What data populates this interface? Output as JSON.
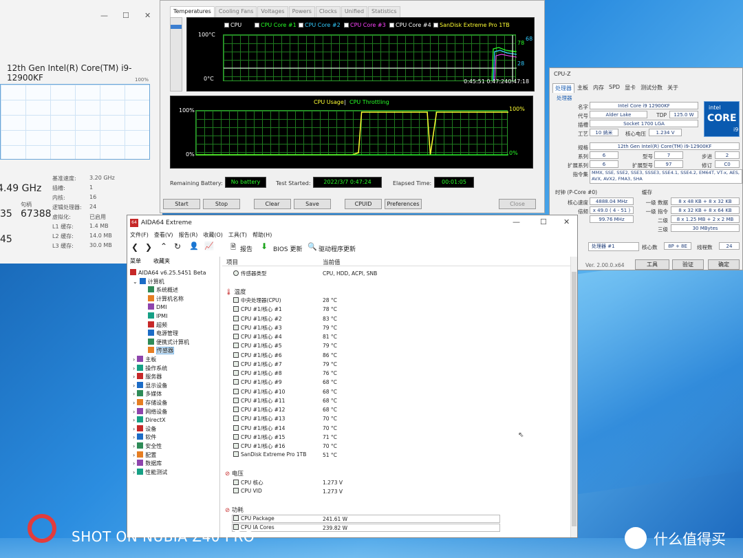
{
  "taskmanager": {
    "minimize": "—",
    "maximize": "☐",
    "close": "✕",
    "cpu_name": "12th Gen Intel(R) Core(TM) i9-12900KF",
    "graph_top": "100%",
    "speed": "4.49 GHz",
    "handles_label": "句柄",
    "num_a": "35",
    "num_b": "67388",
    "num_c": "45",
    "details": [
      {
        "label": "基准速度:",
        "value": "3.20 GHz"
      },
      {
        "label": "插槽:",
        "value": "1"
      },
      {
        "label": "内核:",
        "value": "16"
      },
      {
        "label": "逻辑处理器:",
        "value": "24"
      },
      {
        "label": "虚拟化:",
        "value": "已启用"
      },
      {
        "label": "L1 缓存:",
        "value": "1.4 MB"
      },
      {
        "label": "L2 缓存:",
        "value": "14.0 MB"
      },
      {
        "label": "L3 缓存:",
        "value": "30.0 MB"
      }
    ]
  },
  "stability": {
    "tabs": [
      "Temperatures",
      "Cooling Fans",
      "Voltages",
      "Powers",
      "Clocks",
      "Unified",
      "Statistics"
    ],
    "legend": [
      {
        "label": "CPU",
        "color": "#ffffff"
      },
      {
        "label": "CPU Core #1",
        "color": "#28ff28"
      },
      {
        "label": "CPU Core #2",
        "color": "#33ccff"
      },
      {
        "label": "CPU Core #3",
        "color": "#ff44ff"
      },
      {
        "label": "CPU Core #4",
        "color": "#ffffff"
      },
      {
        "label": "SanDisk Extreme Pro 1TB",
        "color": "#ffff33"
      }
    ],
    "temp_top": "100°C",
    "temp_bottom": "0°C",
    "temp_val_a": "78",
    "temp_val_b": "68",
    "temp_val_c": "28",
    "time_label": "0:45:51 0:47:240:47:18",
    "usage_title": "CPU Usage",
    "throttle_title": "CPU Throttling",
    "usage_top_left": "100%",
    "usage_bottom_left": "0%",
    "usage_top_right": "100%",
    "usage_bottom_right": "0%",
    "remaining_battery_label": "Remaining Battery:",
    "remaining_battery_value": "No battery",
    "test_started_label": "Test Started:",
    "test_started_value": "2022/3/7 0:47:24",
    "elapsed_label": "Elapsed Time:",
    "elapsed_value": "00:01:05",
    "buttons": {
      "start": "Start",
      "stop": "Stop",
      "clear": "Clear",
      "save": "Save",
      "cpuid": "CPUID",
      "preferences": "Preferences",
      "close": "Close"
    },
    "usage_series": [
      {
        "t": 0,
        "v": 0
      },
      {
        "t": 0.5,
        "v": 0
      },
      {
        "t": 0.52,
        "v": 5
      },
      {
        "t": 0.53,
        "v": 100
      },
      {
        "t": 0.74,
        "v": 100
      },
      {
        "t": 0.75,
        "v": 0
      },
      {
        "t": 0.77,
        "v": 100
      },
      {
        "t": 1,
        "v": 100
      }
    ]
  },
  "cpuz": {
    "title": "CPU-Z",
    "tabs": [
      "处理器",
      "主板",
      "内存",
      "SPD",
      "显卡",
      "测试分数",
      "关于"
    ],
    "section": "处理器",
    "name_label": "名字",
    "name": "Intel Core i9 12900KF",
    "code_label": "代号",
    "code": "Alder Lake",
    "tdp_label": "TDP",
    "tdp": "125.0 W",
    "socket_label": "插槽",
    "socket": "Socket 1700 LGA",
    "process_label": "工艺",
    "process": "10 纳米",
    "vcore_label": "核心电压",
    "vcore": "1.234 V",
    "spec_label": "规格",
    "spec": "12th Gen Intel(R) Core(TM) i9-12900KF",
    "family_label": "系列",
    "family": "6",
    "model_label": "型号",
    "model": "7",
    "stepping_label": "步进",
    "stepping": "2",
    "extfam_label": "扩展系列",
    "extfam": "6",
    "extmodel_label": "扩展型号",
    "extmodel": "97",
    "revision_label": "修订",
    "revision": "C0",
    "instr_label": "指令集",
    "instr": "MMX, SSE, SSE2, SSE3, SSSE3, SSE4.1, SSE4.2, EM64T, VT-x, AES, AVX, AVX2, FMA3, SHA",
    "clock_title": "时钟 (P-Core #0)",
    "core_speed_label": "核心速度",
    "core_speed": "4888.04 MHz",
    "mult_label": "倍频",
    "mult": "x 49.0 ( 4 - 51 )",
    "bus": "99.76 MHz",
    "cache_title": "缓存",
    "l1d_label": "一级 数据",
    "l1d": "8 x 48 KB + 8 x 32 KB",
    "l1i_label": "一级 指令",
    "l1i": "8 x 32 KB + 8 x 64 KB",
    "l2_label": "二级",
    "l2": "8 x 1.25 MB + 2 x 2 MB",
    "l3_label": "三级",
    "l3": "30 MBytes",
    "select_label": "处理器 #1",
    "cores_label": "核心数",
    "cores": "8P + 8E",
    "threads_label": "线程数",
    "threads": "24",
    "version": "Ver. 2.00.0.x64",
    "tools": "工具",
    "validate": "验证",
    "ok": "确定",
    "logo_brand": "intel",
    "logo_core": "CORE",
    "logo_tier": "i9"
  },
  "aida": {
    "title": "AIDA64 Extreme",
    "menu": [
      "文件(F)",
      "查看(V)",
      "报告(R)",
      "收藏(O)",
      "工具(T)",
      "帮助(H)"
    ],
    "toolbar": {
      "report": "报告",
      "bios": "BIOS 更新",
      "driver": "驱动程序更新"
    },
    "left_tabs": [
      "菜单",
      "收藏夹"
    ],
    "tree": [
      {
        "label": "AIDA64 v6.25.5451 Beta",
        "level": 0
      },
      {
        "label": "计算机",
        "level": 1
      },
      {
        "label": "系统概述",
        "level": 2
      },
      {
        "label": "计算机名称",
        "level": 2
      },
      {
        "label": "DMI",
        "level": 2
      },
      {
        "label": "IPMI",
        "level": 2
      },
      {
        "label": "超频",
        "level": 2
      },
      {
        "label": "电源管理",
        "level": 2
      },
      {
        "label": "便携式计算机",
        "level": 2
      },
      {
        "label": "传感器",
        "level": 2
      },
      {
        "label": "主板",
        "level": 1
      },
      {
        "label": "操作系统",
        "level": 1
      },
      {
        "label": "服务器",
        "level": 1
      },
      {
        "label": "显示设备",
        "level": 1
      },
      {
        "label": "多媒体",
        "level": 1
      },
      {
        "label": "存储设备",
        "level": 1
      },
      {
        "label": "网络设备",
        "level": 1
      },
      {
        "label": "DirectX",
        "level": 1
      },
      {
        "label": "设备",
        "level": 1
      },
      {
        "label": "软件",
        "level": 1
      },
      {
        "label": "安全性",
        "level": 1
      },
      {
        "label": "配置",
        "level": 1
      },
      {
        "label": "数据库",
        "level": 1
      },
      {
        "label": "性能测试",
        "level": 1
      }
    ],
    "col_item": "项目",
    "col_value": "当前值",
    "sensor_type_label": "传感器类型",
    "sensor_type_value": "CPU, HDD, ACPI, SNB",
    "temp_section": "温度",
    "temps": [
      {
        "name": "中央处理器(CPU)",
        "value": "28 °C"
      },
      {
        "name": "CPU #1/核心 #1",
        "value": "78 °C"
      },
      {
        "name": "CPU #1/核心 #2",
        "value": "83 °C"
      },
      {
        "name": "CPU #1/核心 #3",
        "value": "79 °C"
      },
      {
        "name": "CPU #1/核心 #4",
        "value": "81 °C"
      },
      {
        "name": "CPU #1/核心 #5",
        "value": "79 °C"
      },
      {
        "name": "CPU #1/核心 #6",
        "value": "86 °C"
      },
      {
        "name": "CPU #1/核心 #7",
        "value": "79 °C"
      },
      {
        "name": "CPU #1/核心 #8",
        "value": "76 °C"
      },
      {
        "name": "CPU #1/核心 #9",
        "value": "68 °C"
      },
      {
        "name": "CPU #1/核心 #10",
        "value": "68 °C"
      },
      {
        "name": "CPU #1/核心 #11",
        "value": "68 °C"
      },
      {
        "name": "CPU #1/核心 #12",
        "value": "68 °C"
      },
      {
        "name": "CPU #1/核心 #13",
        "value": "70 °C"
      },
      {
        "name": "CPU #1/核心 #14",
        "value": "70 °C"
      },
      {
        "name": "CPU #1/核心 #15",
        "value": "71 °C"
      },
      {
        "name": "CPU #1/核心 #16",
        "value": "70 °C"
      },
      {
        "name": "SanDisk Extreme Pro 1TB",
        "value": "51 °C"
      }
    ],
    "volt_section": "电压",
    "volts": [
      {
        "name": "CPU 核心",
        "value": "1.273 V"
      },
      {
        "name": "CPU VID",
        "value": "1.273 V"
      }
    ],
    "power_section": "功耗",
    "powers": [
      {
        "name": "CPU Package",
        "value": "241.61 W"
      },
      {
        "name": "CPU IA Cores",
        "value": "239.82 W"
      }
    ]
  },
  "watermark": {
    "text": "SHOT ON NUBIA Z40 PRO",
    "smzdm": "什么值得买"
  }
}
